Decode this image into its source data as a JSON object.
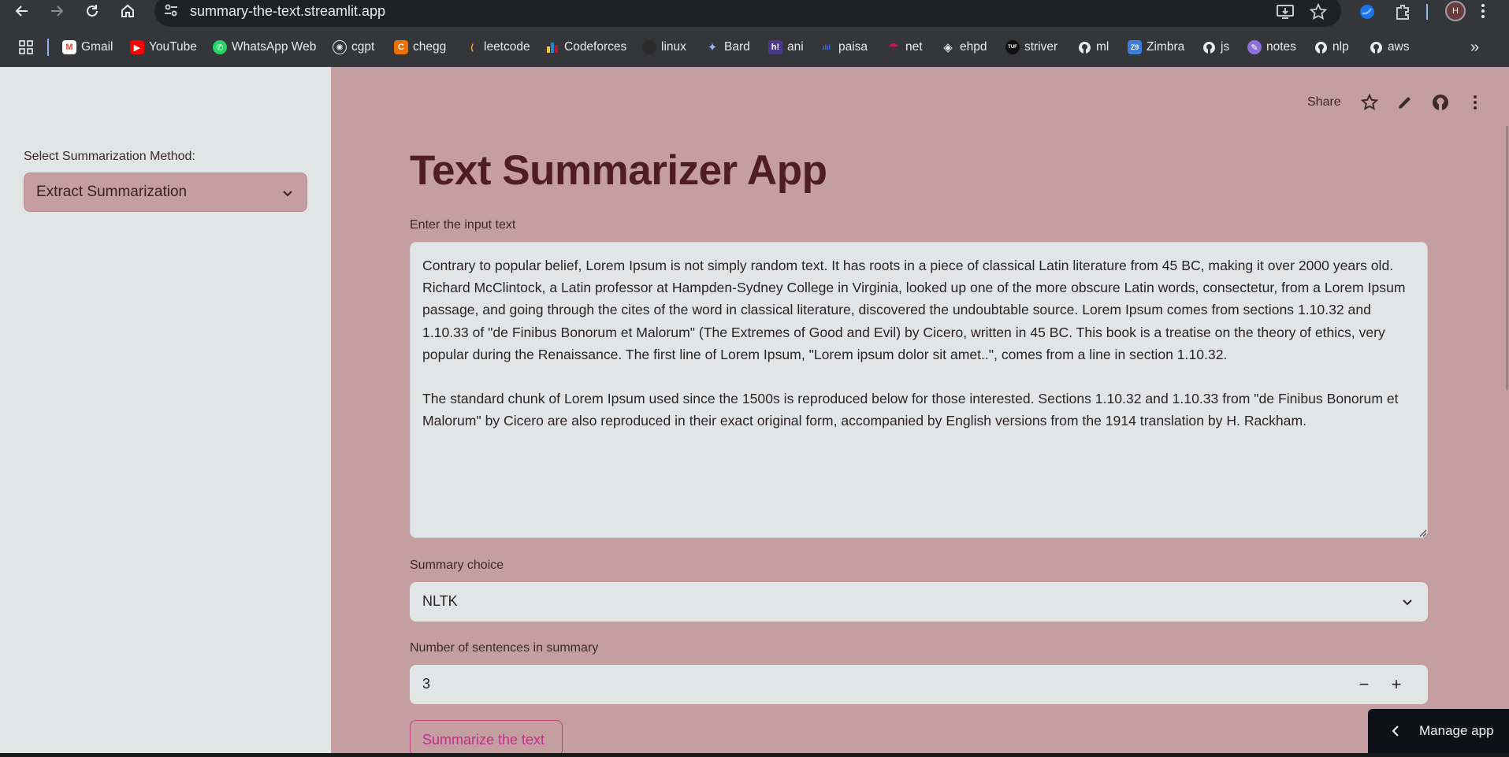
{
  "browser": {
    "url": "summary-the-text.streamlit.app",
    "profile_initial": "H",
    "bookmarks": [
      {
        "label": "Gmail",
        "icon": "gmail-icon",
        "color": "#ea4335"
      },
      {
        "label": "YouTube",
        "icon": "youtube-icon",
        "color": "#ff0000"
      },
      {
        "label": "WhatsApp Web",
        "icon": "whatsapp-icon",
        "color": "#25d366"
      },
      {
        "label": "cgpt",
        "icon": "chatgpt-icon",
        "color": "#e8eaed"
      },
      {
        "label": "chegg",
        "icon": "chegg-icon",
        "color": "#eb7100"
      },
      {
        "label": "leetcode",
        "icon": "leetcode-icon",
        "color": "#ffa116"
      },
      {
        "label": "Codeforces",
        "icon": "codeforces-icon",
        "color": "#1f8acb"
      },
      {
        "label": "linux",
        "icon": "github-icon",
        "color": "#2b2b2b"
      },
      {
        "label": "Bard",
        "icon": "bard-icon",
        "color": "#8ab4f8"
      },
      {
        "label": "ani",
        "icon": "hianime-icon",
        "color": "#4b3a8c"
      },
      {
        "label": "paisa",
        "icon": "paisa-icon",
        "color": "#3a6fd8"
      },
      {
        "label": "net",
        "icon": "umbrella-icon",
        "color": "#c2185b"
      },
      {
        "label": "ehpd",
        "icon": "ehpd-icon",
        "color": "#e8eaed"
      },
      {
        "label": "striver",
        "icon": "tuf-icon",
        "color": "#111111"
      },
      {
        "label": "ml",
        "icon": "github-icon",
        "color": "#e8eaed"
      },
      {
        "label": "Zimbra",
        "icon": "zimbra-icon",
        "color": "#3b7dd8"
      },
      {
        "label": "js",
        "icon": "github-icon",
        "color": "#e8eaed"
      },
      {
        "label": "notes",
        "icon": "notes-icon",
        "color": "#8e6fd8"
      },
      {
        "label": "nlp",
        "icon": "github-icon",
        "color": "#e8eaed"
      },
      {
        "label": "aws",
        "icon": "github-icon",
        "color": "#e8eaed"
      }
    ]
  },
  "sidebar": {
    "method_label": "Select Summarization Method:",
    "method_value": "Extract Summarization"
  },
  "header": {
    "share_label": "Share"
  },
  "main": {
    "title": "Text Summarizer App",
    "input_label": "Enter the input text",
    "input_text": "Contrary to popular belief, Lorem Ipsum is not simply random text. It has roots in a piece of classical Latin literature from 45 BC, making it over 2000 years old. Richard McClintock, a Latin professor at Hampden-Sydney College in Virginia, looked up one of the more obscure Latin words, consectetur, from a Lorem Ipsum passage, and going through the cites of the word in classical literature, discovered the undoubtable source. Lorem Ipsum comes from sections 1.10.32 and 1.10.33 of \"de Finibus Bonorum et Malorum\" (The Extremes of Good and Evil) by Cicero, written in 45 BC. This book is a treatise on the theory of ethics, very popular during the Renaissance. The first line of Lorem Ipsum, \"Lorem ipsum dolor sit amet..\", comes from a line in section 1.10.32.\n\nThe standard chunk of Lorem Ipsum used since the 1500s is reproduced below for those interested. Sections 1.10.32 and 1.10.33 from \"de Finibus Bonorum et Malorum\" by Cicero are also reproduced in their exact original form, accompanied by English versions from the 1914 translation by H. Rackham.",
    "summary_choice_label": "Summary choice",
    "summary_choice_value": "NLTK",
    "num_sentences_label": "Number of sentences in summary",
    "num_sentences_value": "3",
    "decrement_label": "−",
    "increment_label": "+",
    "summarize_button": "Summarize the text"
  },
  "manage_app": {
    "label": "Manage app"
  },
  "colors": {
    "sidebar_bg": "#e1e5e6",
    "main_bg": "#c49ea1",
    "title": "#4e1e22",
    "primary_button": "#c0308a"
  }
}
